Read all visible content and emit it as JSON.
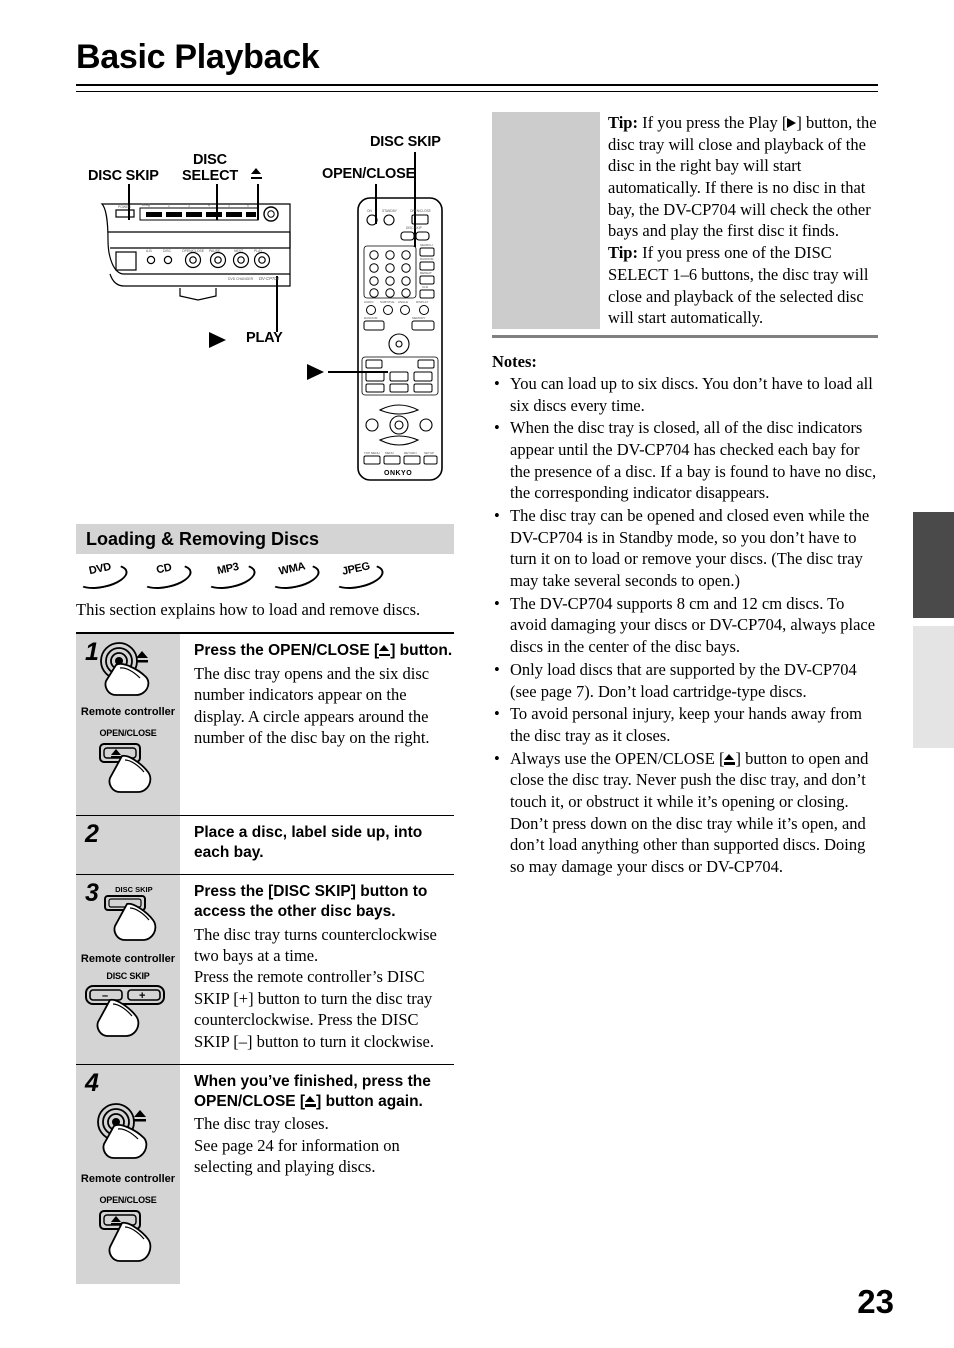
{
  "page": {
    "title": "Basic Playback",
    "number": "23"
  },
  "figure": {
    "labels": [
      {
        "name": "disc-skip-front",
        "text": "DISC SKIP"
      },
      {
        "name": "disc-select",
        "text": "DISC\nSELECT"
      },
      {
        "name": "eject",
        "text": "▲"
      },
      {
        "name": "disc-skip-remote",
        "text": "DISC SKIP"
      },
      {
        "name": "open-close-remote",
        "text": "OPEN/CLOSE"
      },
      {
        "name": "play",
        "text": "PLAY"
      }
    ],
    "disc_skip_front": "DISC SKIP",
    "disc_select_line1": "DISC",
    "disc_select_line2": "SELECT",
    "disc_skip_remote": "DISC SKIP",
    "open_close_remote": "OPEN/CLOSE",
    "play": "PLAY",
    "device_model": "DV-CP704",
    "brand": "ONKYO"
  },
  "section": {
    "heading": "Loading & Removing Discs",
    "formats": [
      "DVD",
      "CD",
      "MP3",
      "WMA",
      "JPEG"
    ],
    "intro": "This section explains how to load and remove discs."
  },
  "steps": [
    {
      "number": "1",
      "heading_a": "Press the OPEN/CLOSE [",
      "heading_b": "] button.",
      "body": "The disc tray opens and the six disc number indicators appear on the display. A circle appears around the number of the disc bay on the right.",
      "remote_caption": "Remote controller",
      "button_caption": "OPEN/CLOSE"
    },
    {
      "number": "2",
      "heading": "Place a disc, label side up, into each bay.",
      "body": "",
      "remote_caption": "",
      "button_caption": ""
    },
    {
      "number": "3",
      "heading": "Press the [DISC SKIP] button to access the other disc bays.",
      "body_1": "The disc tray turns counterclockwise two bays at a time.",
      "body_2": "Press the remote controller’s DISC SKIP [+] button to turn the disc tray counterclockwise. Press the DISC SKIP [–] button to turn it clockwise.",
      "top_button_caption": "DISC SKIP",
      "remote_caption": "Remote controller",
      "button_caption": "DISC SKIP",
      "minus": "–",
      "plus": "+"
    },
    {
      "number": "4",
      "heading_a": "When you’ve finished, press the OPEN/CLOSE [",
      "heading_b": "] button again.",
      "body_1": "The disc tray closes.",
      "body_2": "See page 24 for information on selecting and playing discs.",
      "remote_caption": "Remote controller",
      "button_caption": "OPEN/CLOSE"
    }
  ],
  "tipbox": {
    "tip1_label": "Tip:",
    "tip1_a": " If you press the Play [",
    "tip1_b": "] button, the disc tray will close and playback of the disc in the right bay will start automatically. If there is no disc in that bay, the DV-CP704 will check the other bays and play the first disc it finds.",
    "tip2_label": "Tip:",
    "tip2": " If you press one of the DISC SELECT 1–6 buttons, the disc tray will close and playback of the selected disc will start automatically."
  },
  "notes": {
    "title": "Notes:",
    "bullet": "•",
    "items": [
      "You can load up to six discs. You don’t have to load all six discs every time.",
      "When the disc tray is closed, all of the disc indicators appear until the DV-CP704 has checked each bay for the presence of a disc. If a bay is found to have no disc, the corresponding indicator disappears.",
      "The disc tray can be opened and closed even while the DV-CP704 is in Standby mode, so you don’t have to turn it on to load or remove your discs. (The disc tray may take several seconds to open.)",
      "The DV-CP704 supports 8 cm and 12 cm discs. To avoid damaging your discs or DV-CP704, always place discs in the center of the disc bays.",
      "Only load discs that are supported by the DV-CP704 (see page 7). Don’t load cartridge-type discs.",
      "To avoid personal injury, keep your hands away from the disc tray as it closes."
    ],
    "last_item_a": "Always use the OPEN/CLOSE [",
    "last_item_b": "] button to open and close the disc tray. Never push the disc tray, and don’t touch it, or obstruct it while it’s opening or closing. Don’t press down on the disc tray while it’s open, and don’t load anything other than supported discs. Doing so may damage your discs or DV-CP704."
  },
  "colors": {
    "step_gray": "#d4d4d4",
    "tip_gray": "#cccccc",
    "tab_dark": "#4a4a4a",
    "tab_light": "#e4e4e4"
  }
}
